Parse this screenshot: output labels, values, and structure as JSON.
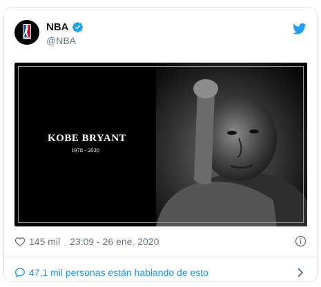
{
  "colors": {
    "link": "#1b95e0",
    "verified": "#1da1f2",
    "muted": "#657786",
    "border": "#e1e8ed"
  },
  "author": {
    "display_name": "NBA",
    "handle": "@NBA",
    "verified": true,
    "logo_text": "NBA"
  },
  "media": {
    "title": "KOBE BRYANT",
    "years": "1978 - 2020"
  },
  "meta": {
    "likes": "145 mil",
    "timestamp": "23:09 - 26 ene. 2020"
  },
  "conversation": {
    "label": "47,1 mil personas están hablando de esto"
  },
  "icons": {
    "brand": "twitter-bird-icon",
    "like": "heart-icon",
    "info": "info-icon",
    "reply": "speech-bubble-icon",
    "more": "chevron-right-icon"
  }
}
